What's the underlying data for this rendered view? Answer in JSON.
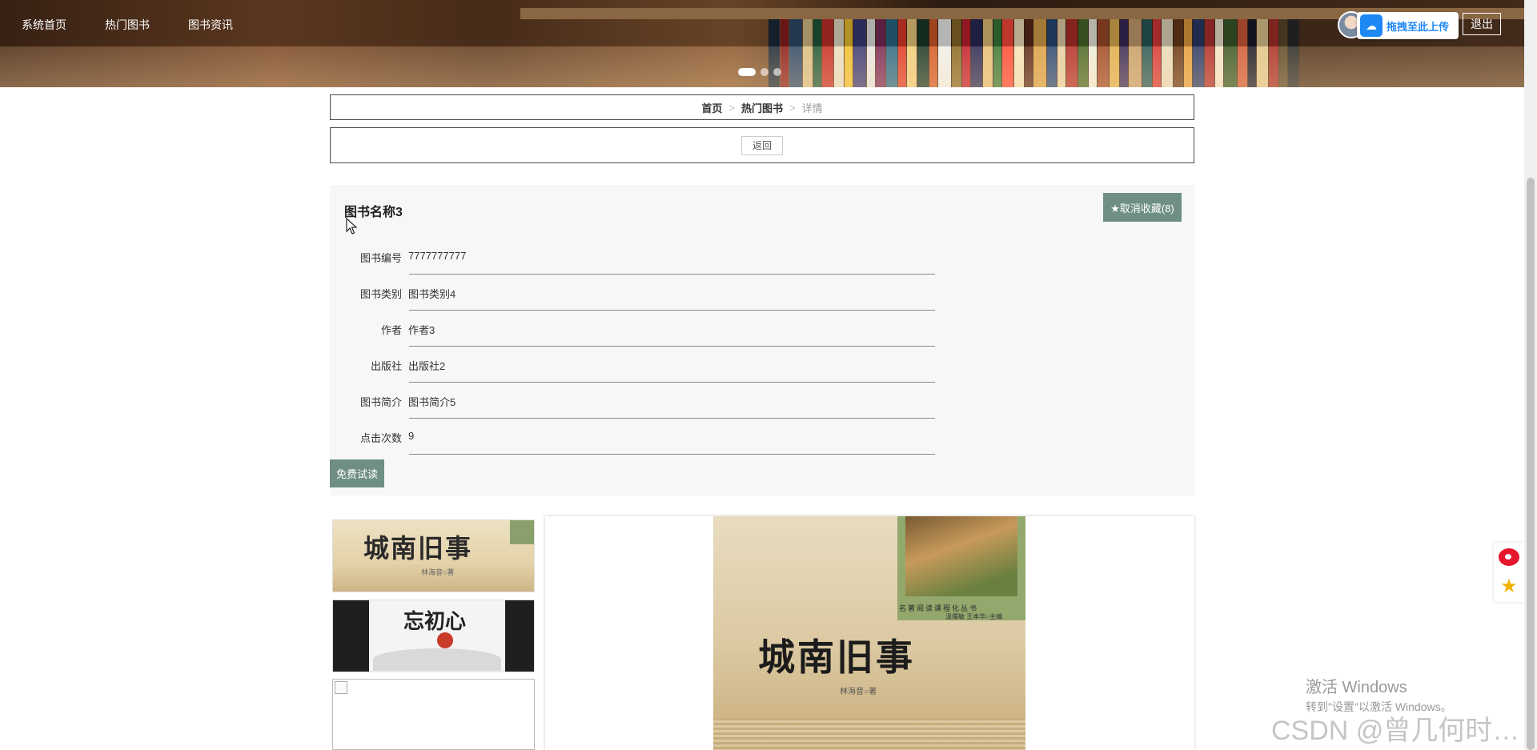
{
  "nav": {
    "items": [
      {
        "label": "系统首页"
      },
      {
        "label": "热门图书"
      },
      {
        "label": "图书资讯"
      }
    ],
    "upload_label": "拖拽至此上传",
    "logout_label": "退出"
  },
  "breadcrumb": {
    "home": "首页",
    "separator": ">",
    "section": "热门图书",
    "current": "详情"
  },
  "back_label": "返回",
  "book": {
    "title": "图书名称3",
    "favorite_label": "★取消收藏(8)",
    "fields": [
      {
        "label": "图书编号",
        "value": "7777777777"
      },
      {
        "label": "图书类别",
        "value": "图书类别4"
      },
      {
        "label": "作者",
        "value": "作者3"
      },
      {
        "label": "出版社",
        "value": "出版社2"
      },
      {
        "label": "图书简介",
        "value": "图书简介5"
      },
      {
        "label": "点击次数",
        "value": "9"
      }
    ],
    "trial_label": "免费试读"
  },
  "gallery": {
    "thumb1": {
      "title": "城南旧事",
      "author": "林海音○著"
    },
    "thumb2": {
      "title": "忘初心"
    },
    "main": {
      "title": "城南旧事",
      "author": "林海音○著",
      "series": "名著阅读课程化丛书",
      "editors": "温儒敏 王本华○主编"
    }
  },
  "watermark": {
    "activate_title": "激活 Windows",
    "activate_sub": "转到\"设置\"以激活 Windows。",
    "csdn": "CSDN @曾几何时…"
  },
  "colors": {
    "accent_button": "#6f8f86",
    "upload_blue": "#1e88f5"
  }
}
